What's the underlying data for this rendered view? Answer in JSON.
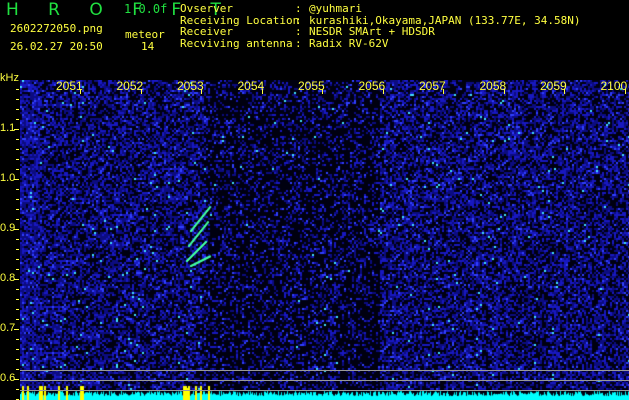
{
  "header": {
    "app": "H R O F F T",
    "version": "1.0.0f",
    "filename": "2602272050.png",
    "datetime": "26.02.27 20:50",
    "mode": "meteor",
    "count": "14"
  },
  "info": [
    {
      "label": "Ovserver",
      "value": "@yuhmari"
    },
    {
      "label": "Receiving Location",
      "value": "kurashiki,Okayama,JAPAN (133.77E, 34.58N)"
    },
    {
      "label": "Receiver",
      "value": "NESDR SMArt + HDSDR"
    },
    {
      "label": "Recviving antenna",
      "value": "Radix RV-62V"
    }
  ],
  "yaxis": {
    "unit": "kHz",
    "ticks": [
      "1.1",
      "1.0",
      "0.9",
      "0.8",
      "0.7",
      "0.6"
    ]
  },
  "xaxis": {
    "ticks": [
      "2051",
      "2052",
      "2053",
      "2054",
      "2055",
      "2056",
      "2057",
      "2058",
      "2059",
      "2100"
    ]
  },
  "colors": {
    "label": "#ffff40",
    "logo": "#20e040",
    "noise": "#1010c0",
    "hist": "#00ffff"
  }
}
